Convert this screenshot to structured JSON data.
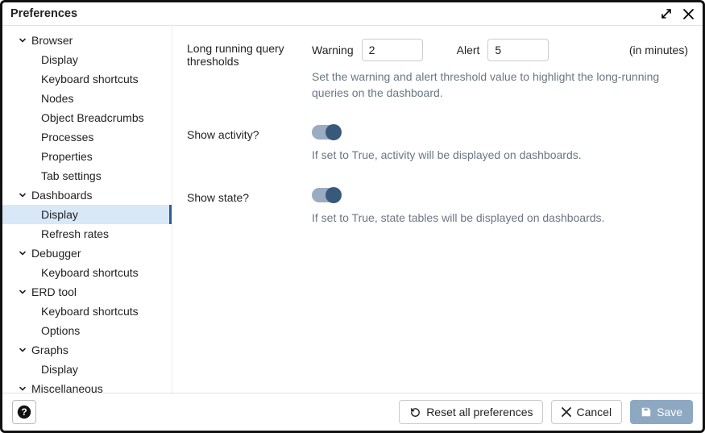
{
  "window": {
    "title": "Preferences"
  },
  "sidebar": {
    "groups": [
      {
        "label": "Browser",
        "expanded": true,
        "items": [
          "Display",
          "Keyboard shortcuts",
          "Nodes",
          "Object Breadcrumbs",
          "Processes",
          "Properties",
          "Tab settings"
        ]
      },
      {
        "label": "Dashboards",
        "expanded": true,
        "items": [
          "Display",
          "Refresh rates"
        ],
        "selected_index": 0
      },
      {
        "label": "Debugger",
        "expanded": true,
        "items": [
          "Keyboard shortcuts"
        ]
      },
      {
        "label": "ERD tool",
        "expanded": true,
        "items": [
          "Keyboard shortcuts",
          "Options"
        ]
      },
      {
        "label": "Graphs",
        "expanded": true,
        "items": [
          "Display"
        ]
      },
      {
        "label": "Miscellaneous",
        "expanded": true,
        "items": []
      }
    ]
  },
  "settings": {
    "thresholds": {
      "label": "Long running query thresholds",
      "warning_label": "Warning",
      "warning_value": "2",
      "alert_label": "Alert",
      "alert_value": "5",
      "units": "(in minutes)",
      "help": "Set the warning and alert threshold value to highlight the long-running queries on the dashboard."
    },
    "show_activity": {
      "label": "Show activity?",
      "value": true,
      "help": "If set to True, activity will be displayed on dashboards."
    },
    "show_state": {
      "label": "Show state?",
      "value": true,
      "help": "If set to True, state tables will be displayed on dashboards."
    }
  },
  "footer": {
    "reset": "Reset all preferences",
    "cancel": "Cancel",
    "save": "Save"
  }
}
